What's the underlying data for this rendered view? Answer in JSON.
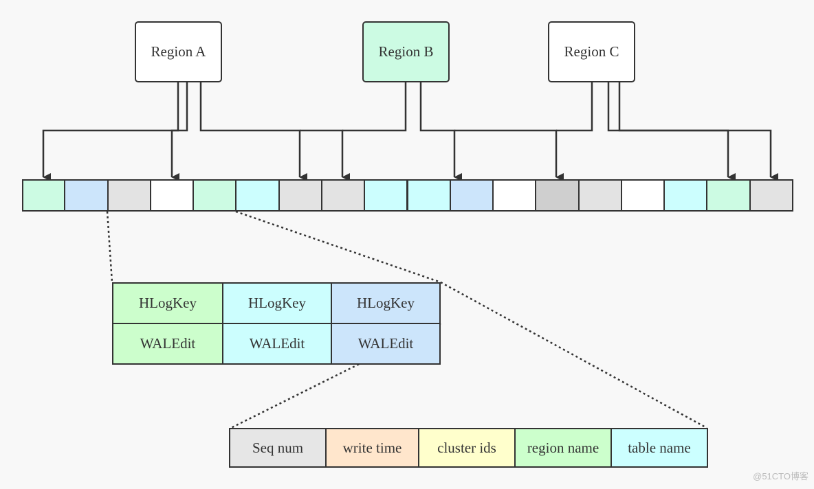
{
  "regions": [
    {
      "label": "Region A",
      "color": "#ffffff"
    },
    {
      "label": "Region B",
      "color": "#ccfbe3"
    },
    {
      "label": "Region C",
      "color": "#ffffff"
    }
  ],
  "wal_entries": {
    "count": 18,
    "colors": [
      "#ccfbe3",
      "#cce5fb",
      "#e3e3e3",
      "#ffffff",
      "#ccfbe3",
      "#ccfefe",
      "#e3e3e3",
      "#e3e3e3",
      "#ccfefe",
      "#ccfefe",
      "#cce5fb",
      "#ffffff",
      "#cfcfcf",
      "#e3e3e3",
      "#ffffff",
      "#ccfefe",
      "#ccfbe3",
      "#e3e3e3"
    ]
  },
  "arrows": {
    "region_a_targets": [
      1,
      4,
      7,
      8
    ],
    "region_b_targets": [
      7,
      8,
      11,
      13
    ],
    "region_c_targets": [
      11,
      13,
      17,
      18
    ]
  },
  "entry_detail": {
    "columns": [
      {
        "key": "HLogKey",
        "value": "WALEdit",
        "color": "#ccfecc"
      },
      {
        "key": "HLogKey",
        "value": "WALEdit",
        "color": "#ccfefe"
      },
      {
        "key": "HLogKey",
        "value": "WALEdit",
        "color": "#cce5fb"
      }
    ]
  },
  "hlogkey_fields": [
    {
      "label": "Seq num",
      "color": "#e6e6e6"
    },
    {
      "label": "write time",
      "color": "#ffe6cc"
    },
    {
      "label": "cluster ids",
      "color": "#ffffcc"
    },
    {
      "label": "region name",
      "color": "#ccffcc"
    },
    {
      "label": "table name",
      "color": "#ccffff"
    }
  ],
  "watermark": "@51CTO博客"
}
